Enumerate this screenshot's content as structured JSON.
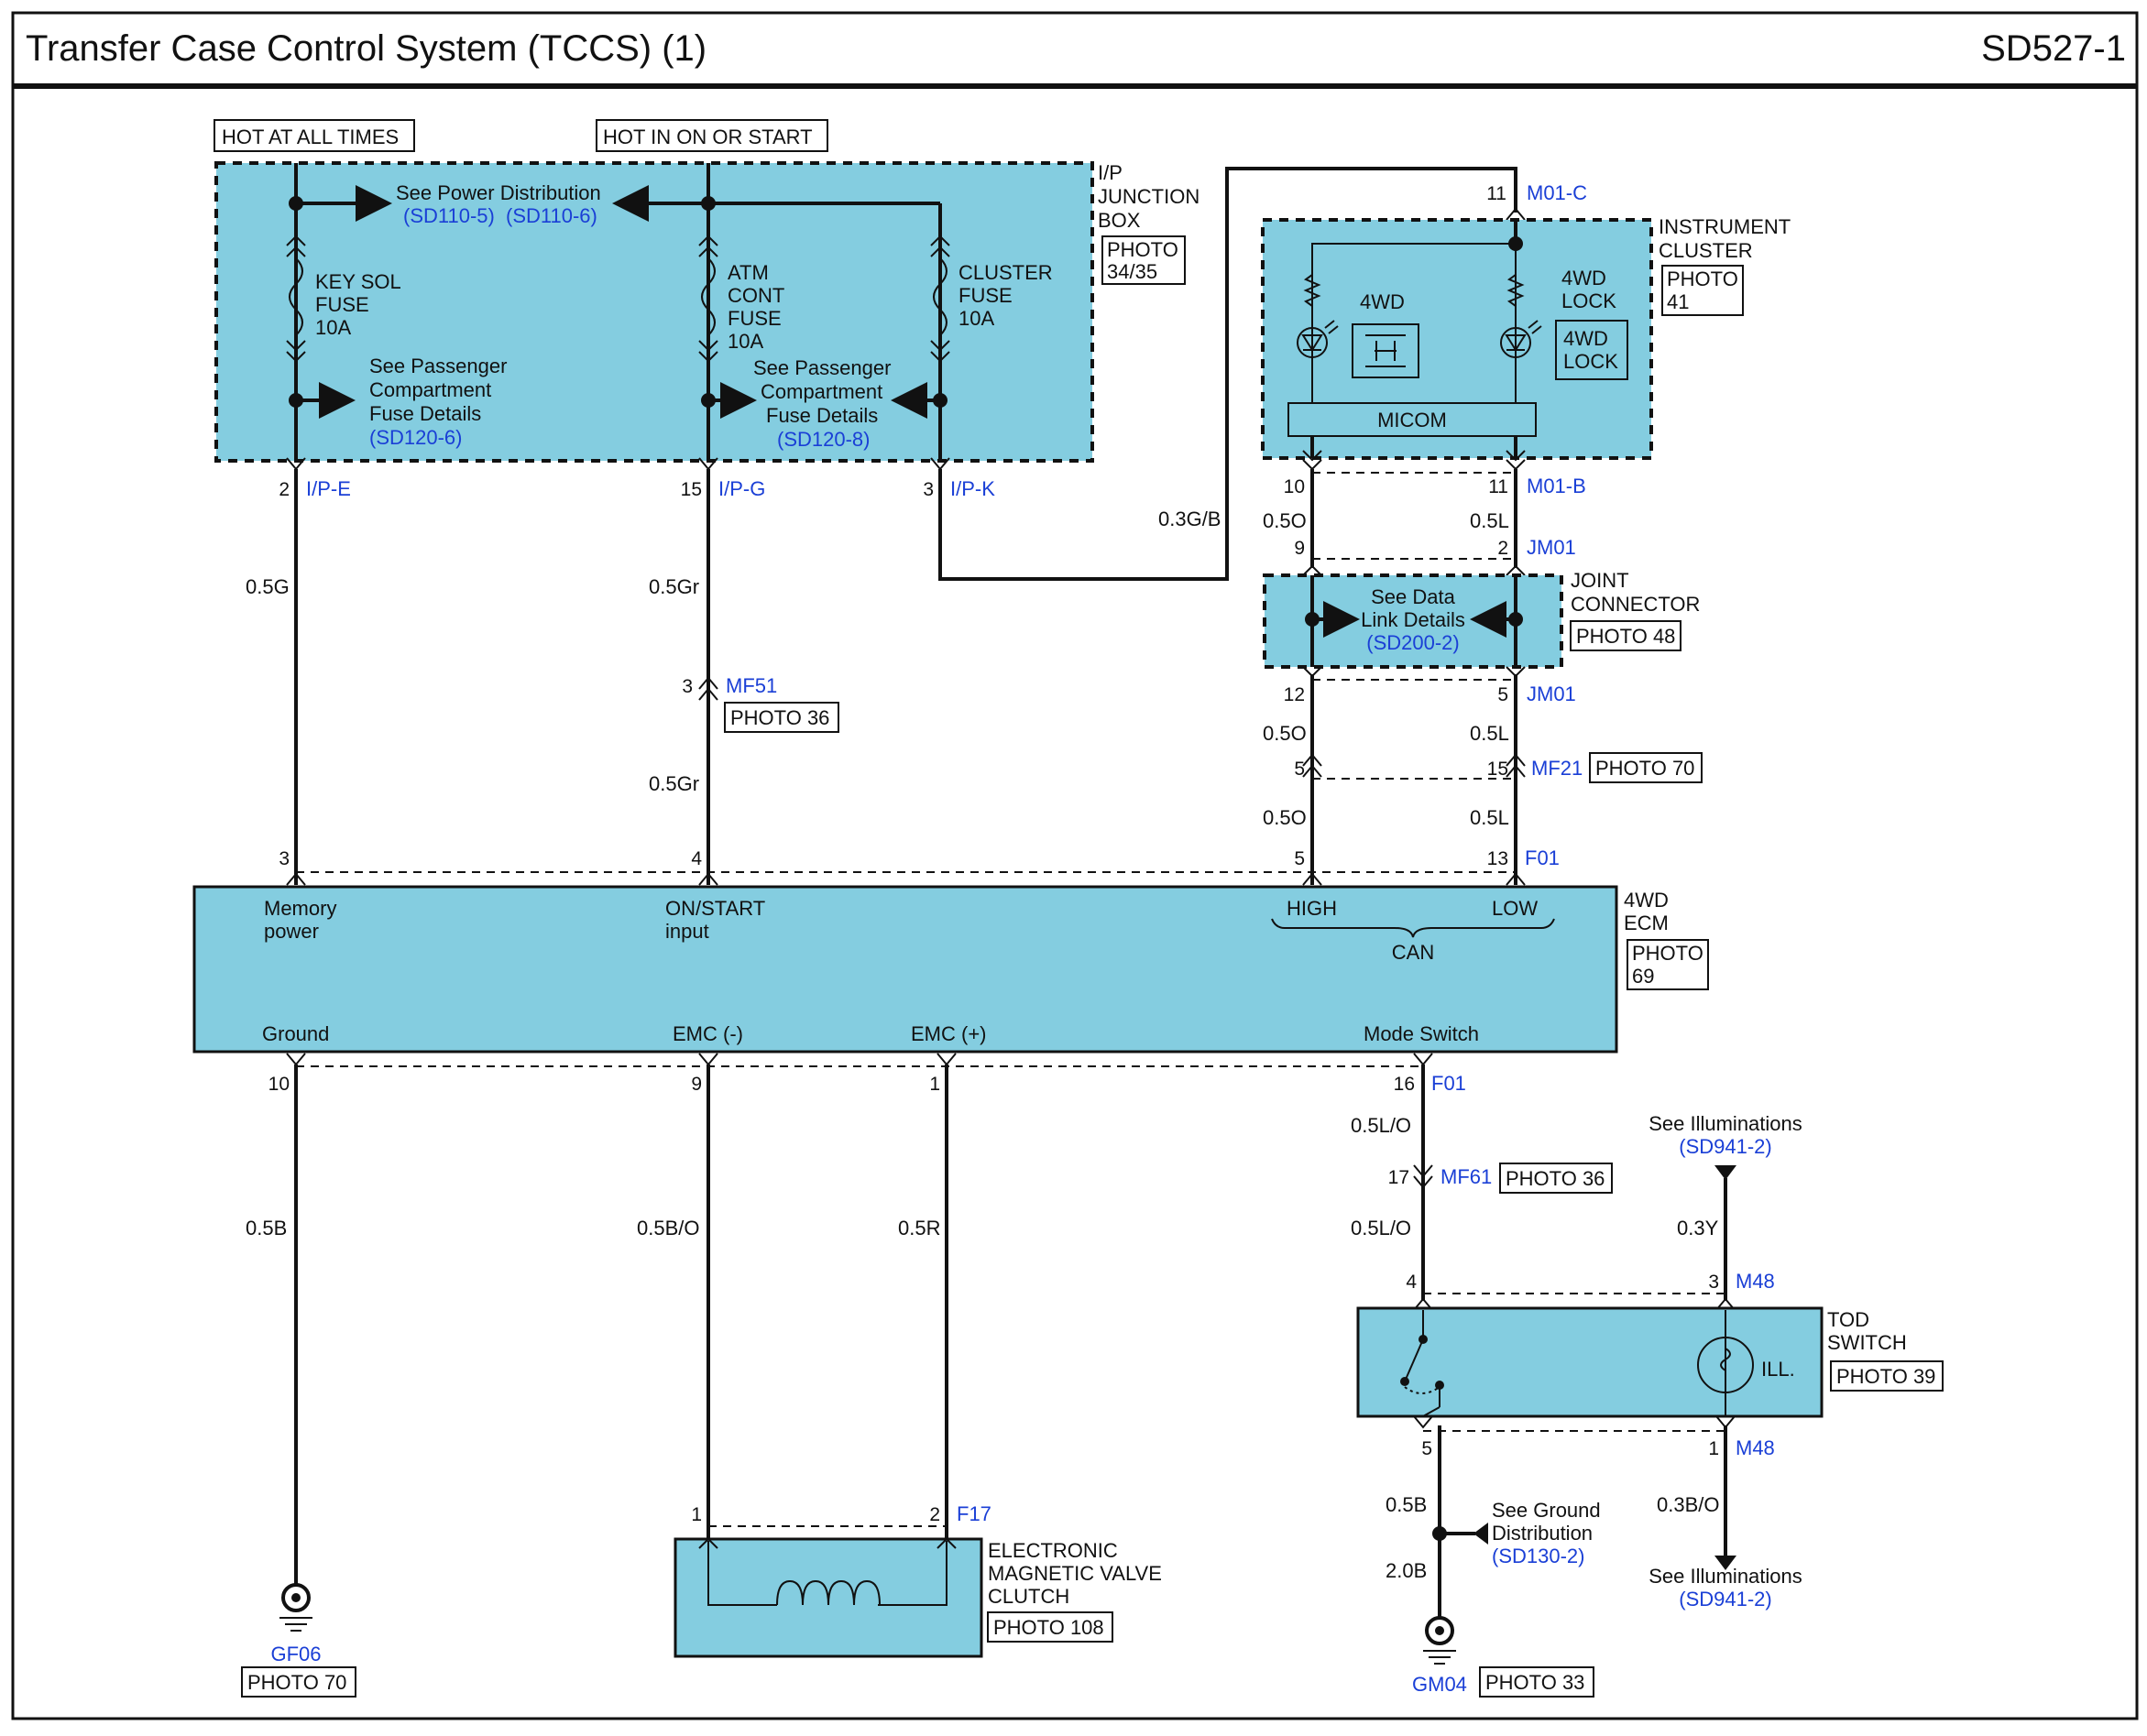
{
  "header": {
    "title": "Transfer Case Control System (TCCS) (1)",
    "page_code": "SD527-1"
  },
  "power": {
    "hot_at_all_times": "HOT AT ALL TIMES",
    "hot_in_on_or_start": "HOT IN ON OR START"
  },
  "junction_box": {
    "name_lines": [
      "I/P",
      "JUNCTION",
      "BOX"
    ],
    "photo_lines": [
      "PHOTO",
      "34/35"
    ],
    "see_power": "See Power Distribution",
    "power_ref1": "(SD110-5)",
    "power_ref2": "(SD110-6)",
    "key_sol_fuse": [
      "KEY SOL",
      "FUSE",
      "10A"
    ],
    "atm_cont_fuse": [
      "ATM",
      "CONT",
      "FUSE",
      "10A"
    ],
    "cluster_fuse": [
      "CLUSTER",
      "FUSE",
      "10A"
    ],
    "see_pass1": [
      "See Passenger",
      "Compartment",
      "Fuse Details"
    ],
    "pass_ref1": "(SD120-6)",
    "see_pass2": [
      "See Passenger",
      "Compartment",
      "Fuse Details"
    ],
    "pass_ref2": "(SD120-8)"
  },
  "connectors": {
    "ip_e": "I/P-E",
    "ip_g": "I/P-G",
    "ip_k": "I/P-K",
    "m01c": "M01-C",
    "m01b": "M01-B",
    "jm01_top": "JM01",
    "jm01_bot": "JM01",
    "mf51": "MF51",
    "mf21": "MF21",
    "mf61": "MF61",
    "f01_top": "F01",
    "f01_bot": "F01",
    "f17": "F17",
    "m48_top": "M48",
    "m48_bot": "M48",
    "gf06": "GF06",
    "gm04": "GM04"
  },
  "pins": {
    "p2": "2",
    "p15": "15",
    "p3a": "3",
    "p11a": "11",
    "p10a": "10",
    "p11b": "11",
    "p9": "9",
    "p2b": "2",
    "p12": "12",
    "p5a": "5",
    "p3b": "3",
    "p5b": "5",
    "p15b": "15",
    "p3c": "3",
    "p4": "4",
    "p5c": "5",
    "p13": "13",
    "p10b": "10",
    "p9b": "9",
    "p1a": "1",
    "p16": "16",
    "p17": "17",
    "p4b": "4",
    "p3d": "3",
    "p5d": "5",
    "p1b": "1",
    "p1c": "1",
    "p2c": "2"
  },
  "wires": {
    "w_05g": "0.5G",
    "w_05gr1": "0.5Gr",
    "w_05gr2": "0.5Gr",
    "w_03gb": "0.3G/B",
    "w_05o1": "0.5O",
    "w_05l1": "0.5L",
    "w_05o2": "0.5O",
    "w_05l2": "0.5L",
    "w_05o3": "0.5O",
    "w_05l3": "0.5L",
    "w_05b": "0.5B",
    "w_05bo": "0.5B/O",
    "w_05r": "0.5R",
    "w_05lo1": "0.5L/O",
    "w_05lo2": "0.5L/O",
    "w_03y": "0.3Y",
    "w_05b2": "0.5B",
    "w_20b": "2.0B",
    "w_03bo": "0.3B/O"
  },
  "cluster": {
    "name_lines": [
      "INSTRUMENT",
      "CLUSTER"
    ],
    "photo_lines": [
      "PHOTO",
      "41"
    ],
    "lamp1": "4WD",
    "lamp2_lines": [
      "4WD",
      "LOCK"
    ],
    "lock_icon_lines": [
      "4WD",
      "LOCK"
    ],
    "micom": "MICOM"
  },
  "joint": {
    "name_lines": [
      "JOINT",
      "CONNECTOR"
    ],
    "photo": "PHOTO 48",
    "see_data": [
      "See Data",
      "Link Details"
    ],
    "data_ref": "(SD200-2)"
  },
  "photos": {
    "mf51": "PHOTO 36",
    "mf21": "PHOTO 70",
    "mf61": "PHOTO 36",
    "gf06": "PHOTO 70",
    "gm04": "PHOTO 33",
    "evc": "PHOTO 108",
    "tod": "PHOTO 39"
  },
  "ecm": {
    "name_lines": [
      "4WD",
      "ECM"
    ],
    "photo_lines": [
      "PHOTO",
      "69"
    ],
    "memory_power": [
      "Memory",
      "power"
    ],
    "on_start": [
      "ON/START",
      "input"
    ],
    "high": "HIGH",
    "low": "LOW",
    "can": "CAN",
    "ground": "Ground",
    "emc_minus": "EMC (-)",
    "emc_plus": "EMC (+)",
    "mode_switch": "Mode Switch"
  },
  "evc": {
    "name_lines": [
      "ELECTRONIC",
      "MAGNETIC VALVE",
      "CLUTCH"
    ]
  },
  "tod": {
    "name_lines": [
      "TOD",
      "SWITCH"
    ],
    "ill": "ILL."
  },
  "illum": {
    "see_top": "See Illuminations",
    "ref_top": "(SD941-2)",
    "see_bot": "See Illuminations",
    "ref_bot": "(SD941-2)"
  },
  "ground_dist": {
    "lines": [
      "See Ground",
      "Distribution"
    ],
    "ref": "(SD130-2)"
  }
}
